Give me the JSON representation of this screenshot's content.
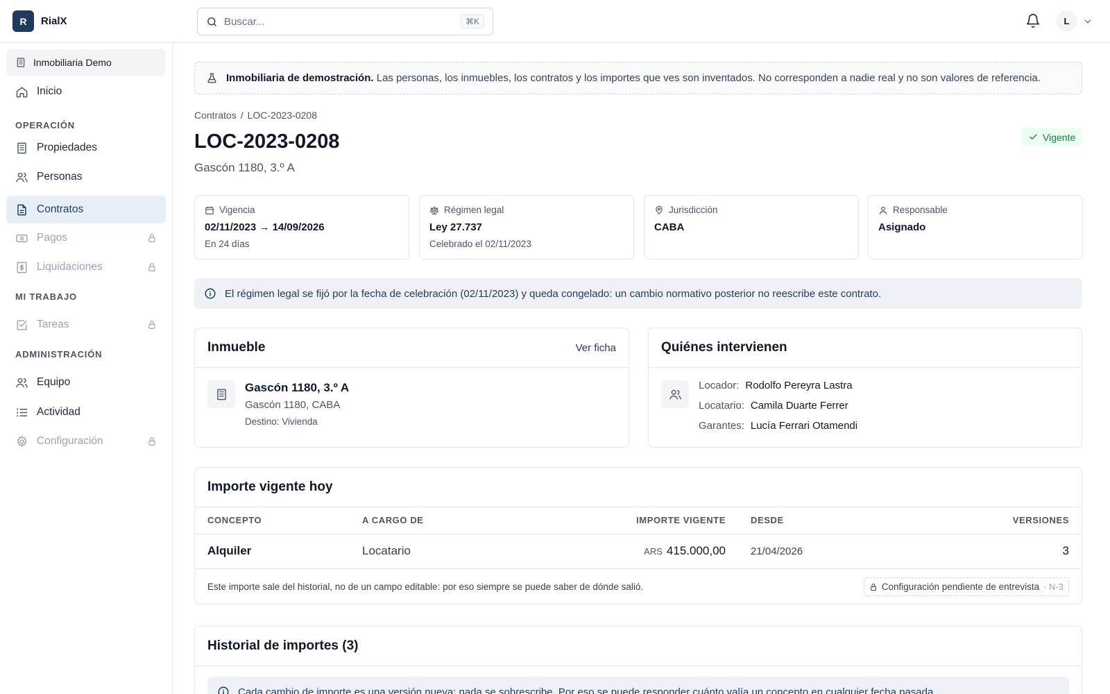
{
  "app": {
    "logo_letter": "R",
    "name": "RialX"
  },
  "search": {
    "placeholder": "Buscar...",
    "shortcut": "⌘K"
  },
  "user": {
    "initial": "L"
  },
  "sidebar": {
    "org": "Inmobiliaria Demo",
    "home": "Inicio",
    "sections": {
      "operacion": "OPERACIÓN",
      "mi_trabajo": "MI TRABAJO",
      "administracion": "ADMINISTRACIÓN"
    },
    "items": {
      "propiedades": "Propiedades",
      "personas": "Personas",
      "contratos": "Contratos",
      "pagos": "Pagos",
      "liquidaciones": "Liquidaciones",
      "tareas": "Tareas",
      "equipo": "Equipo",
      "actividad": "Actividad",
      "configuracion": "Configuración"
    }
  },
  "banner": {
    "bold": "Inmobiliaria de demostración.",
    "text": "Las personas, los inmuebles, los contratos y los importes que ves son inventados. No corresponden a nadie real y no son valores de referencia."
  },
  "breadcrumb": {
    "parent": "Contratos",
    "sep": "/",
    "current": "LOC-2023-0208"
  },
  "contract": {
    "code": "LOC-2023-0208",
    "address": "Gascón 1180, 3.º A",
    "status": "Vigente"
  },
  "stats": {
    "vigencia": {
      "label": "Vigencia",
      "value": "02/11/2023 → 14/09/2026",
      "hint": "En 24 días"
    },
    "regimen": {
      "label": "Régimen legal",
      "value": "Ley 27.737",
      "hint": "Celebrado el 02/11/2023"
    },
    "jurisdiccion": {
      "label": "Jurisdicción",
      "value": "CABA"
    },
    "responsable": {
      "label": "Responsable",
      "value": "Asignado"
    }
  },
  "regime_note": "El régimen legal se fijó por la fecha de celebración (02/11/2023) y queda congelado: un cambio normativo posterior no reescribe este contrato.",
  "inmueble": {
    "title": "Inmueble",
    "link": "Ver ficha",
    "name": "Gascón 1180, 3.º A",
    "address": "Gascón 1180, CABA",
    "destino": "Destino: Vivienda"
  },
  "partes": {
    "title": "Quiénes intervienen",
    "rows": [
      {
        "role": "Locador:",
        "name": "Rodolfo Pereyra Lastra"
      },
      {
        "role": "Locatario:",
        "name": "Camila Duarte Ferrer"
      },
      {
        "role": "Garantes:",
        "name": "Lucía Ferrari Otamendi"
      }
    ]
  },
  "importe": {
    "title": "Importe vigente hoy",
    "columns": [
      "CONCEPTO",
      "A CARGO DE",
      "IMPORTE VIGENTE",
      "DESDE",
      "VERSIONES"
    ],
    "row": {
      "concepto": "Alquiler",
      "cargo": "Locatario",
      "currency": "ARS",
      "amount": "415.000,00",
      "desde": "21/04/2026",
      "versiones": "3"
    },
    "footnote": "Este importe sale del historial, no de un campo editable: por eso siempre se puede saber de dónde salió.",
    "pending": "Configuración pendiente de entrevista",
    "pending_code": "· N-3"
  },
  "historial": {
    "title": "Historial de importes (3)",
    "note": "Cada cambio de importe es una versión nueva: nada se sobrescribe. Por eso se puede responder cuánto valía un concepto en cualquier fecha pasada."
  }
}
